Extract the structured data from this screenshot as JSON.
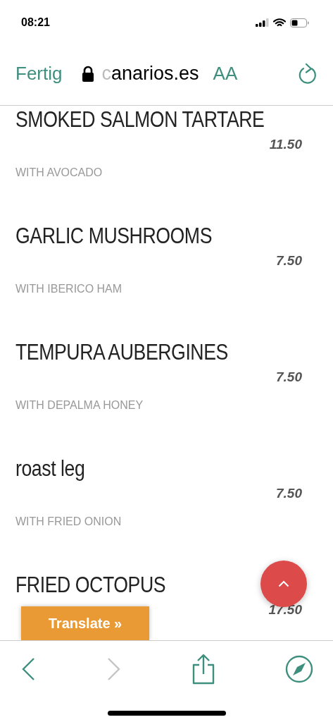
{
  "status_bar": {
    "time": "08:21"
  },
  "browser_bar": {
    "done": "Fertig",
    "domain_faded": "c",
    "domain": "anarios.es",
    "text_size": "AA"
  },
  "menu_items": [
    {
      "name": "SMOKED SALMON TARTARE",
      "price": "11.50",
      "description": "WITH AVOCADO"
    },
    {
      "name": "GARLIC MUSHROOMS",
      "price": "7.50",
      "description": "WITH IBERICO HAM"
    },
    {
      "name": "TEMPURA AUBERGINES",
      "price": "7.50",
      "description": "WITH DEPALMA HONEY"
    },
    {
      "name": "roast leg",
      "price": "7.50",
      "description": "WITH FRIED ONION"
    },
    {
      "name": "FRIED OCTOPUS",
      "price": "17.50"
    }
  ],
  "translate_button": "Translate »",
  "toolbar": {
    "back_disabled": false,
    "forward_disabled": true
  }
}
